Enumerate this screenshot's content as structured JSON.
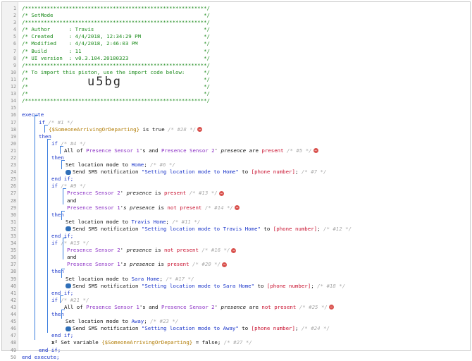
{
  "header_lines": [
    "/**********************************************************/",
    "/* SetMode                                                */",
    "/**********************************************************/",
    "/* Author      : Travis                                   */",
    "/* Created     : 4/4/2018, 12:34:29 PM                    */",
    "/* Modified    : 4/4/2018, 2:46:03 PM                     */",
    "/* Build       : 11                                       */",
    "/* UI version  : v0.3.104.20180323                        */",
    "/**********************************************************/",
    "/* To import this piston, use the import code below:      */",
    "/*                                                        */",
    "/*                                                        */",
    "/*                                                        */",
    "/**********************************************************/"
  ],
  "import_code": "u5bg",
  "line_numbers": [
    "1",
    "2",
    "3",
    "4",
    "5",
    "6",
    "7",
    "8",
    "9",
    "10",
    "11",
    "12",
    "13",
    "14",
    "15",
    "16",
    "17",
    "18",
    "19",
    "20",
    "21",
    "22",
    "23",
    "24",
    "25",
    "26",
    "27",
    "28",
    "29",
    "30",
    "31",
    "32",
    "33",
    "34",
    "35",
    "36",
    "37",
    "38",
    "39",
    "40",
    "41",
    "42",
    "43",
    "44",
    "45",
    "46",
    "47",
    "48",
    "49",
    "50"
  ],
  "code": {
    "execute": "execute",
    "if": "if",
    "then": "then",
    "and": "and",
    "end_if": "end if;",
    "end_execute": "end execute;",
    "c1": "/* #1 */",
    "c28": "/* #28 */",
    "c4": "/* #4 */",
    "c5": "/* #5 */",
    "c6": "/* #6 */",
    "c7": "/* #7 */",
    "c9": "/* #9 */",
    "c13": "/* #13 */",
    "c14": "/* #14 */",
    "c11": "/* #11 */",
    "c12": "/* #12 */",
    "c15": "/* #15 */",
    "c16": "/* #16 */",
    "c20": "/* #20 */",
    "c17": "/* #17 */",
    "c18": "/* #18 */",
    "c21": "/* #21 */",
    "c25": "/* #25 */",
    "c23": "/* #23 */",
    "c24": "/* #24 */",
    "c27": "/* #27 */",
    "var_name": "{$SomeoneArrivingOrDeparting}",
    "is_true": " is true ",
    "all_of": "All of ",
    "ps1": "Presence Sensor 1",
    "ps2": "Presence Sensor 2",
    "s_and": "'s and ",
    "s_presence": "'s presence",
    "presence": "presence",
    "are": " are ",
    "is": " is ",
    "present": "present",
    "not_present": "not present",
    "set_mode": "Set location mode to ",
    "home": "Home",
    "travis_home": "Travis Home",
    "sara_home": "Sara Home",
    "away": "Away",
    "send_sms": "Send SMS notification ",
    "msg_home": "\"Setting location mode to Home\"",
    "msg_travis": "\"Setting location mode to Travis Home\"",
    "msg_sara": "\"Setting location mode to Sara Home\"",
    "msg_away": "\"Setting location mode to Away\"",
    "to": " to ",
    "phone": "[phone number]",
    "semi": ";",
    "set_var": "Set variable ",
    "eq_false": " = false;"
  },
  "colors": {
    "comment": "#1e8c1e",
    "keyword": "#1a35c9",
    "device": "#8a2fc4",
    "value": "#c8102e",
    "variable": "#b07a00"
  },
  "icons": [
    "minus-circle-icon",
    "message-bubble-icon",
    "variable-icon"
  ]
}
